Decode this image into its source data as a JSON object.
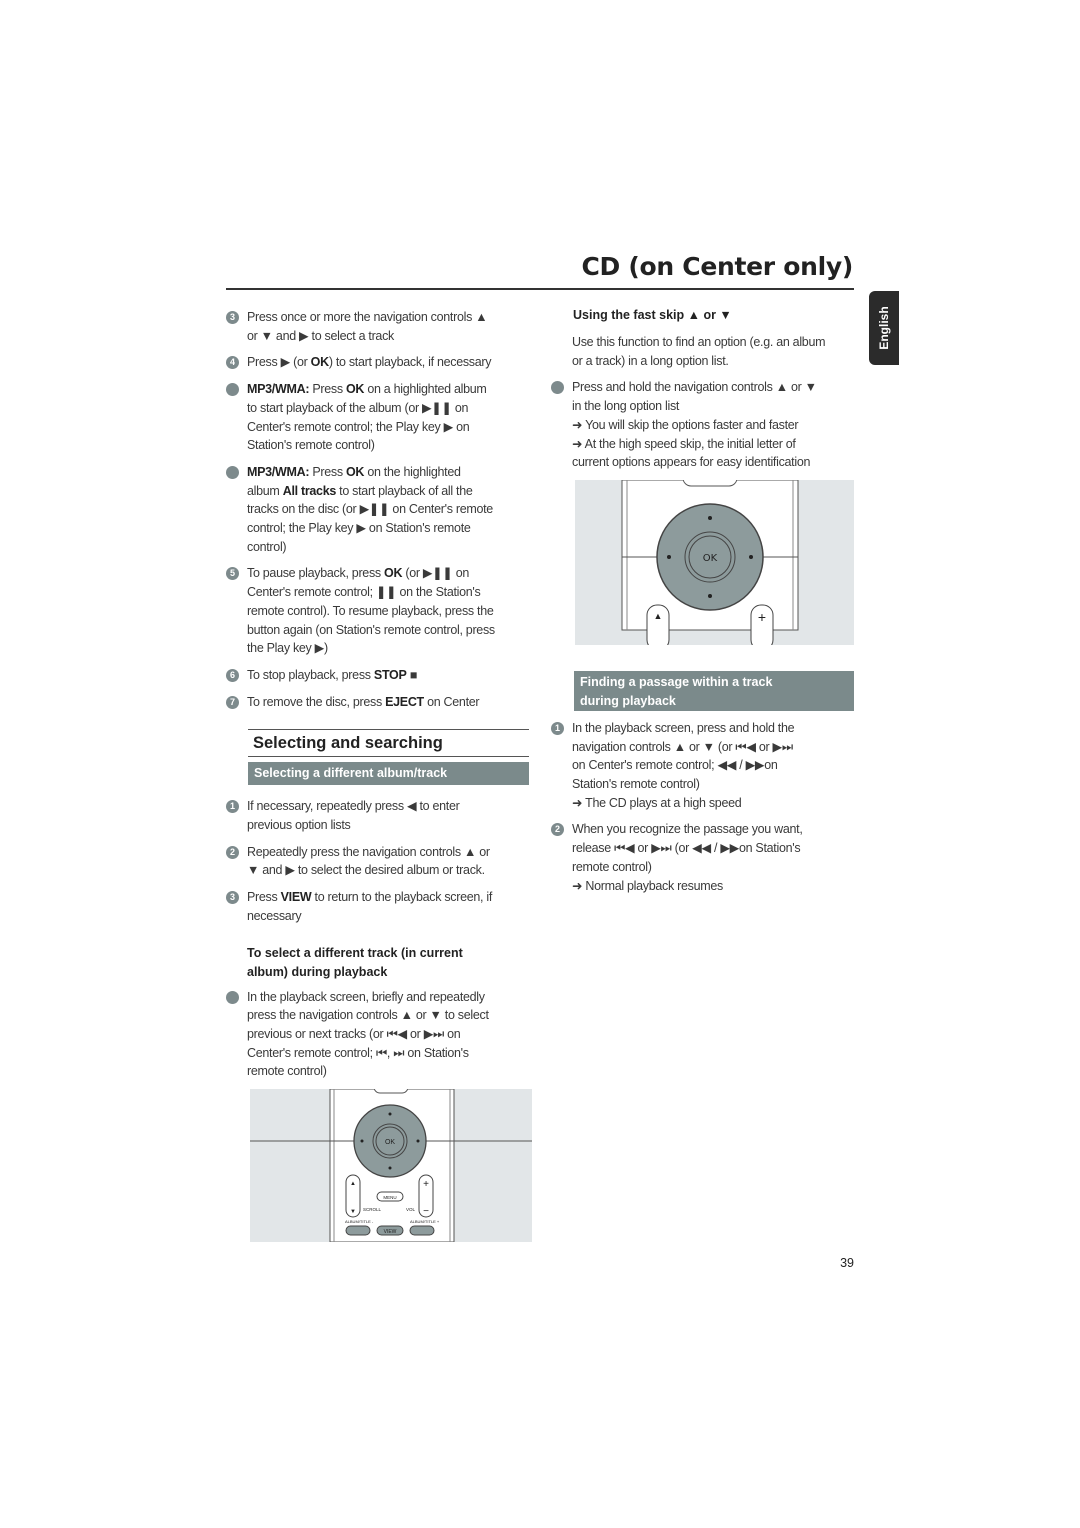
{
  "header": {
    "title": "CD (on Center only)",
    "language_tab": "English"
  },
  "page_number": "39",
  "left": {
    "blocks": [
      {
        "bullet": "3",
        "lines": [
          [
            "Press once or more the navigation controls  ▲"
          ],
          [
            "or ▼  and ▶ to select a track"
          ]
        ]
      },
      {
        "bullet": "4",
        "lines": [
          [
            "Press ▶  (or ",
            {
              "t": "OK",
              "b": 1
            },
            ") to start playback, if necessary"
          ]
        ]
      },
      {
        "bullet": "",
        "lines": [
          [
            {
              "t": "MP3/WMA:",
              "b": 1
            },
            " Press ",
            {
              "t": "OK",
              "b": 1
            },
            " on a highlighted album"
          ],
          [
            "to start playback of the album (or ▶❚❚  on"
          ],
          [
            "Center's remote control; the Play key ▶  on"
          ],
          [
            "Station's remote control)"
          ]
        ]
      },
      {
        "bullet": "",
        "lines": [
          [
            {
              "t": "MP3/WMA:",
              "b": 1
            },
            "  Press ",
            {
              "t": "OK",
              "b": 1
            },
            " on the highlighted"
          ],
          [
            "album ",
            {
              "t": "All tracks",
              "b": 1
            },
            " to start playback of all the"
          ],
          [
            "tracks on the disc (or ▶❚❚  on Center's remote"
          ],
          [
            "control; the Play key ▶  on Station's remote"
          ],
          [
            "control)"
          ]
        ]
      },
      {
        "bullet": "5",
        "lines": [
          [
            "To pause playback, press ",
            {
              "t": "OK",
              "b": 1
            },
            " (or ▶❚❚  on"
          ],
          [
            "Center's remote control; ❚❚  on the Station's"
          ],
          [
            "remote control).  To resume playback, press the"
          ],
          [
            "button again (on Station's remote control, press"
          ],
          [
            "the Play key ▶)"
          ]
        ]
      },
      {
        "bullet": "6",
        "lines": [
          [
            "To stop playback, press ",
            {
              "t": "STOP",
              "b": 1
            },
            " ■"
          ]
        ]
      },
      {
        "bullet": "7",
        "lines": [
          [
            "To remove the disc, press ",
            {
              "t": "EJECT",
              "b": 1
            },
            " on Center"
          ]
        ]
      }
    ],
    "section_heading": "Selecting and searching",
    "section_bar": "Selecting a different album/track",
    "blocks2": [
      {
        "bullet": "1",
        "lines": [
          [
            "If necessary, repeatedly press ◀  to enter"
          ],
          [
            "previous option lists"
          ]
        ]
      },
      {
        "bullet": "2",
        "lines": [
          [
            "Repeatedly press the navigation controls  ▲  or"
          ],
          [
            "▼  and ▶  to select the desired album or track."
          ]
        ]
      },
      {
        "bullet": "3",
        "lines": [
          [
            "Press ",
            {
              "t": "VIEW",
              "b": 1
            },
            "  to return to the playback screen, if"
          ],
          [
            "necessary"
          ]
        ]
      }
    ],
    "subheading": [
      "To select a different track (in current",
      "album) during playback"
    ],
    "blocks3": [
      {
        "bullet": "",
        "lines": [
          [
            "In the playback screen, briefly and repeatedly"
          ],
          [
            "press the navigation controls ▲  or  ▼ to select"
          ],
          [
            "previous or next tracks (or ⏮◀  or ▶⏭ on"
          ],
          [
            "Center's remote control; ⏮,  ⏭ on Station's"
          ],
          [
            "remote control)"
          ]
        ]
      }
    ],
    "remote_labels": {
      "ok": "OK",
      "menu": "MENU",
      "scroll": "SCROLL",
      "vol": "VOL",
      "album_minus": "ALBUM/TITLE -",
      "album_plus": "ALBUM/TITLE +",
      "view": "VIEW"
    }
  },
  "right": {
    "heading": "Using the fast skip  ▲  or   ▼",
    "blocks": [
      {
        "bullet": "none",
        "lines": [
          [
            "Use this function to find an option (e.g. an album"
          ],
          [
            "or a track) in a long option list."
          ]
        ]
      },
      {
        "bullet": "",
        "lines": [
          [
            "Press and hold the navigation controls  ▲  or   ▼"
          ],
          [
            "in the long option list"
          ],
          [
            "➜ You will skip the options faster and faster"
          ],
          [
            "➜ At the high speed skip, the initial letter of"
          ],
          [
            "current options appears for easy identification"
          ]
        ]
      }
    ],
    "remote_labels": {
      "ok": "OK"
    },
    "section_bar": [
      "Finding a passage within a track",
      "during playback"
    ],
    "blocks2": [
      {
        "bullet": "1",
        "lines": [
          [
            "In the playback screen, press and hold the"
          ],
          [
            "navigation controls  ▲  or   ▼ (or ⏮◀  or ▶⏭"
          ],
          [
            "on Center's remote control;  ◀◀ /   ▶▶on"
          ],
          [
            "Station's remote control)"
          ],
          [
            "➜ The CD plays at a high speed"
          ]
        ]
      },
      {
        "bullet": "2",
        "lines": [
          [
            "When you recognize the passage you want,"
          ],
          [
            "release ⏮◀  or  ▶⏭ (or ◀◀ /   ▶▶on Station's"
          ],
          [
            "remote control)"
          ],
          [
            "➜ Normal playback resumes"
          ]
        ]
      }
    ]
  },
  "colors": {
    "bar": "#7b8a8b",
    "bullet": "#7d8a8c",
    "image_bg": "#e2e6e8",
    "dial": "#8d9b9c"
  }
}
